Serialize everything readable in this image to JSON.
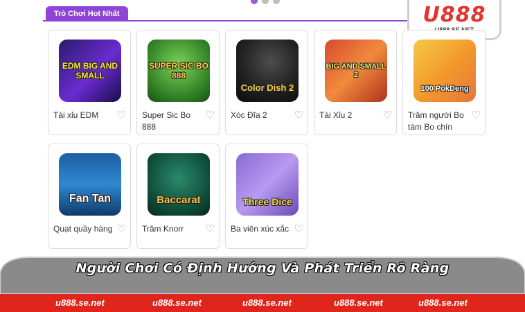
{
  "section": {
    "tab_label": "Trò Chơi Hot Nhất"
  },
  "logo": {
    "main": "U888",
    "sub": "U888.SE.NET"
  },
  "games": [
    {
      "title": "Tài xỉu EDM",
      "art": "EDM BIG AND SMALL"
    },
    {
      "title": "Super Sic Bo 888",
      "art": "SUPER SIC BO 888"
    },
    {
      "title": "Xóc Đĩa 2",
      "art": "Color Dish 2"
    },
    {
      "title": "Tài Xỉu 2",
      "art": "BIG AND SMALL 2"
    },
    {
      "title": "Trăm người Bo tám Bo chín",
      "art": "100 PokDeng"
    },
    {
      "title": "Quạt quầy hàng",
      "art": "Fan Tan"
    },
    {
      "title": "Trăm Knorr",
      "art": "Baccarat"
    },
    {
      "title": "Ba viên xúc xắc",
      "art": "Three Dice"
    }
  ],
  "icons": {
    "favorite": "heart-outline-icon"
  },
  "banner": {
    "text": "Người Chơi Có Định Hướng Và Phát Triển Rõ Ràng"
  },
  "footer": {
    "links": [
      "u888.se.net",
      "u888.se.net",
      "u888.se.net",
      "u888.se.net",
      "u888.se.net"
    ]
  },
  "colors": {
    "accent": "#8e44d6",
    "footer": "#e0261c",
    "banner": "#8a8a8a"
  }
}
